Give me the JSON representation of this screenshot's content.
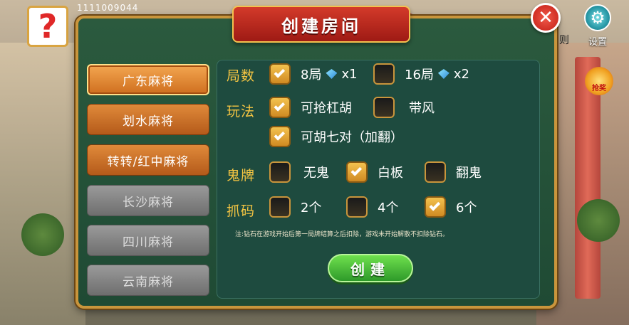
{
  "header": {
    "account_id": "1111009044",
    "help_icon_glyph": "?",
    "settings_label": "设置",
    "badge_label": "抢奖",
    "cropped_label": "则"
  },
  "dialog": {
    "title": "创建房间",
    "close_glyph": "✕",
    "tabs": [
      {
        "label": "广东麻将",
        "state": "active"
      },
      {
        "label": "划水麻将",
        "state": "enabled"
      },
      {
        "label": "转转/红中麻将",
        "state": "enabled"
      },
      {
        "label": "长沙麻将",
        "state": "disabled"
      },
      {
        "label": "四川麻将",
        "state": "disabled"
      },
      {
        "label": "云南麻将",
        "state": "disabled"
      }
    ],
    "rounds": {
      "label": "局数",
      "options": [
        {
          "text": "8局",
          "cost": "x1",
          "checked": true
        },
        {
          "text": "16局",
          "cost": "x2",
          "checked": false
        }
      ]
    },
    "play_mode": {
      "label": "玩法",
      "options": [
        {
          "text": "可抢杠胡",
          "checked": true
        },
        {
          "text": "带风",
          "checked": false
        },
        {
          "text": "可胡七对（加翻）",
          "checked": true
        }
      ]
    },
    "ghost_tile": {
      "label": "鬼牌",
      "options": [
        {
          "text": "无鬼",
          "checked": false
        },
        {
          "text": "白板",
          "checked": true
        },
        {
          "text": "翻鬼",
          "checked": false
        }
      ]
    },
    "horse_code": {
      "label": "抓码",
      "options": [
        {
          "text": "2个",
          "checked": false
        },
        {
          "text": "4个",
          "checked": false
        },
        {
          "text": "6个",
          "checked": true
        }
      ]
    },
    "note": "注:钻石在游戏开始后第一局牌结算之后扣除，游戏未开始解散不扣除钻石。",
    "create_label": "创建"
  },
  "colors": {
    "accent_gold": "#f5c542",
    "panel_green": "#1e4b3f",
    "banner_red": "#c62a1e",
    "create_green": "#3fb83a"
  }
}
